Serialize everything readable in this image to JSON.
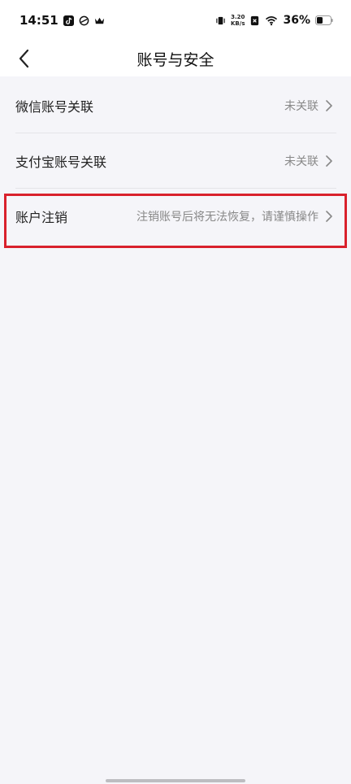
{
  "status_bar": {
    "time": "14:51",
    "net_speed_value": "3.20",
    "net_speed_unit": "KB/s",
    "battery_percent": "36%"
  },
  "header": {
    "title": "账号与安全"
  },
  "items": [
    {
      "label": "微信账号关联",
      "value": "未关联"
    },
    {
      "label": "支付宝账号关联",
      "value": "未关联"
    },
    {
      "label": "账户注销",
      "value": "注销账号后将无法恢复，请谨慎操作"
    }
  ],
  "colors": {
    "highlight": "#d9212c",
    "background": "#f5f5f9"
  }
}
